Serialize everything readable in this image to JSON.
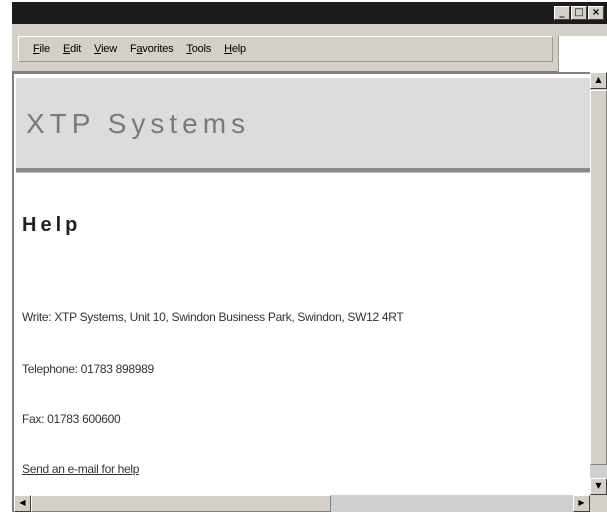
{
  "window": {
    "controls": {
      "minimize": "_",
      "maximize": "□",
      "close": "×"
    }
  },
  "menu": {
    "items": [
      {
        "label": "File",
        "accel": "F",
        "rest": "ile"
      },
      {
        "label": "Edit",
        "accel": "E",
        "rest": "dit"
      },
      {
        "label": "View",
        "accel": "V",
        "rest": "iew"
      },
      {
        "label": "Favorites",
        "accel": "a",
        "pre": "F",
        "rest": "vorites"
      },
      {
        "label": "Tools",
        "accel": "T",
        "rest": "ools"
      },
      {
        "label": "Help",
        "accel": "H",
        "rest": "elp"
      }
    ]
  },
  "banner": {
    "title": "XTP Systems"
  },
  "page": {
    "heading": "Help",
    "write": "Write: XTP Systems, Unit 10, Swindon Business Park, Swindon, SW12 4RT",
    "telephone": "Telephone: 01783 898989",
    "fax": "Fax: 01783 600600",
    "email_link": "Send an e-mail for help"
  },
  "scrollbars": {
    "up": "▲",
    "down": "▼",
    "left": "◀",
    "right": "▶"
  }
}
